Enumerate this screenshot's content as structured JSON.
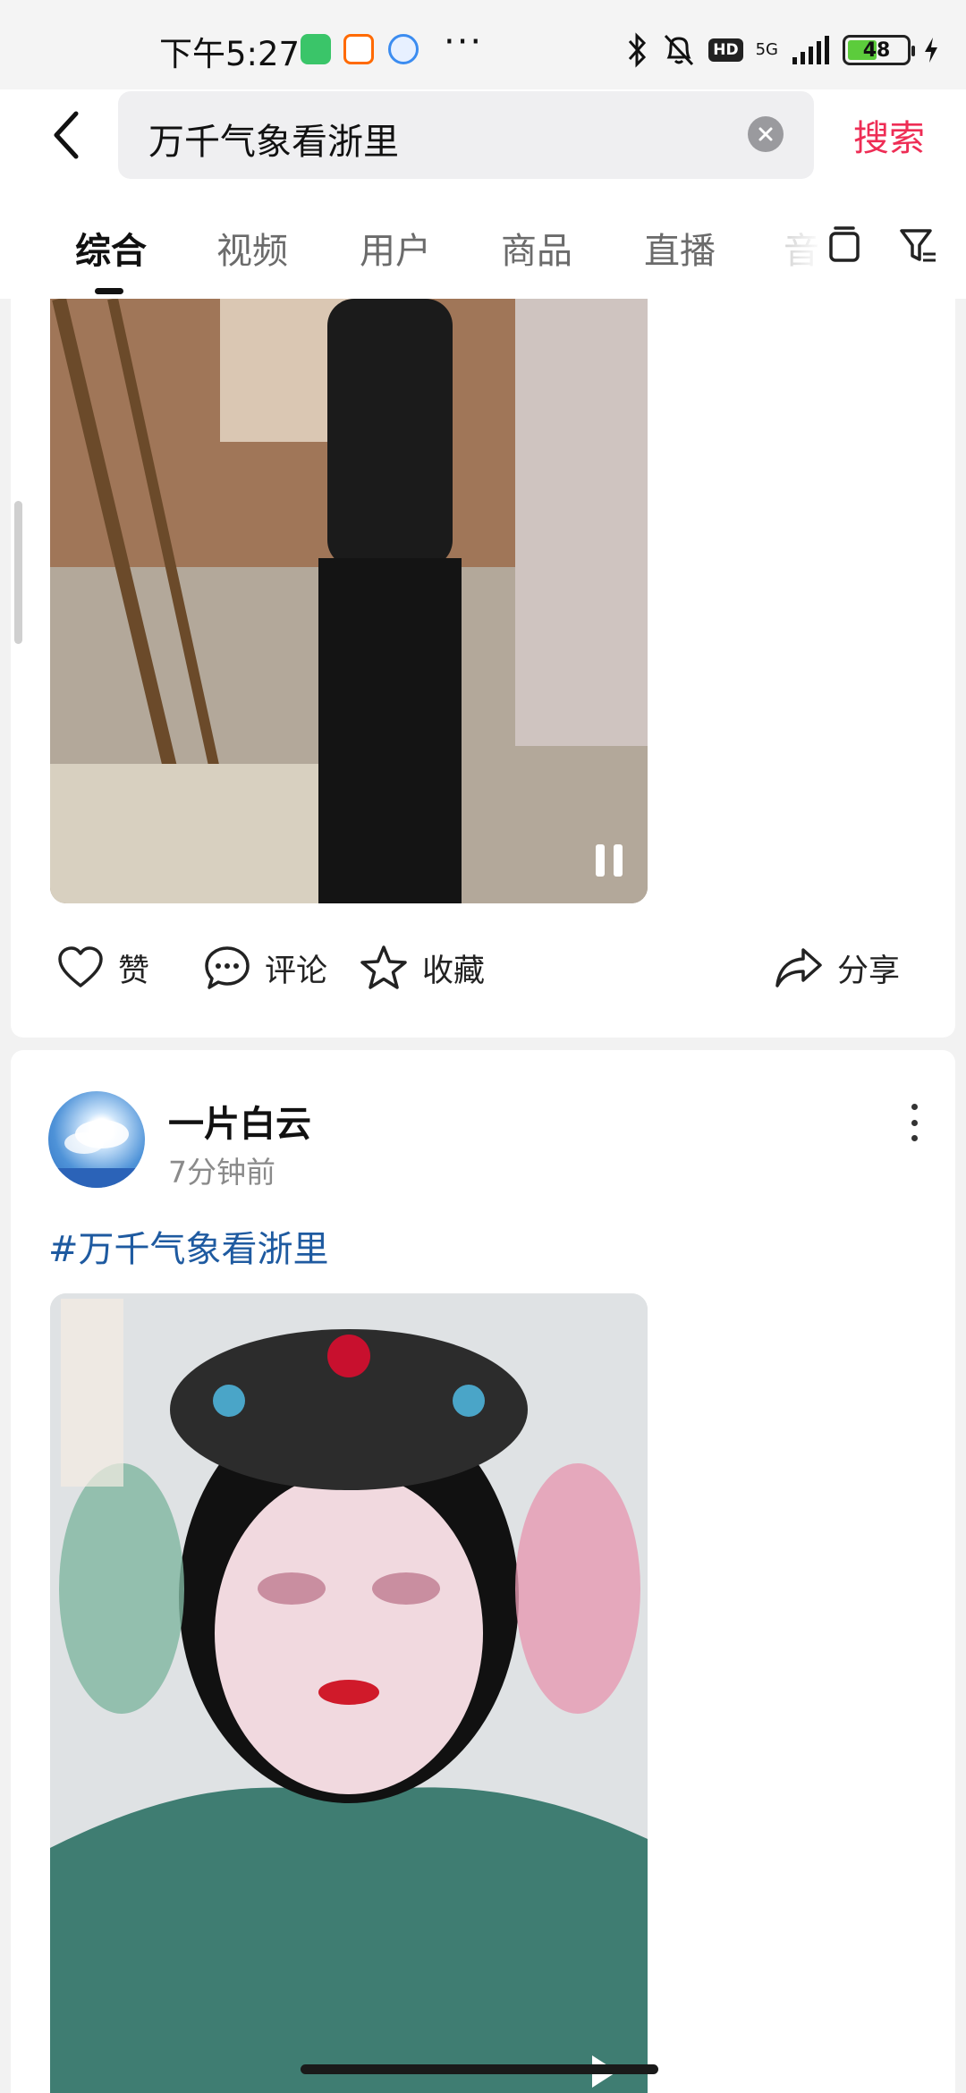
{
  "status_bar": {
    "time": "下午5:27",
    "battery_level": "48",
    "network": "5G",
    "hd_badge": "HD",
    "overflow_dots": "···",
    "apps": [
      {
        "icon": "wechat-icon",
        "color": "#3ac569"
      },
      {
        "icon": "58-app-icon",
        "color": "#ff6a00"
      },
      {
        "icon": "cloud-app-icon",
        "color": "#3b8cf0"
      }
    ]
  },
  "search": {
    "query": "万千气象看浙里",
    "button_label": "搜索"
  },
  "tabs": [
    {
      "label": "综合",
      "active": true
    },
    {
      "label": "视频",
      "active": false
    },
    {
      "label": "用户",
      "active": false
    },
    {
      "label": "商品",
      "active": false
    },
    {
      "label": "直播",
      "active": false
    },
    {
      "label": "音",
      "active": false
    }
  ],
  "feed": {
    "post1": {
      "actions": {
        "like": "赞",
        "comment": "评论",
        "favorite": "收藏",
        "share": "分享"
      }
    },
    "post2": {
      "user_name": "一片白云",
      "time": "7分钟前",
      "hashtag": "#万千气象看浙里"
    }
  },
  "colors": {
    "accent": "#ee2d55",
    "hashtag": "#1e5aa0"
  }
}
